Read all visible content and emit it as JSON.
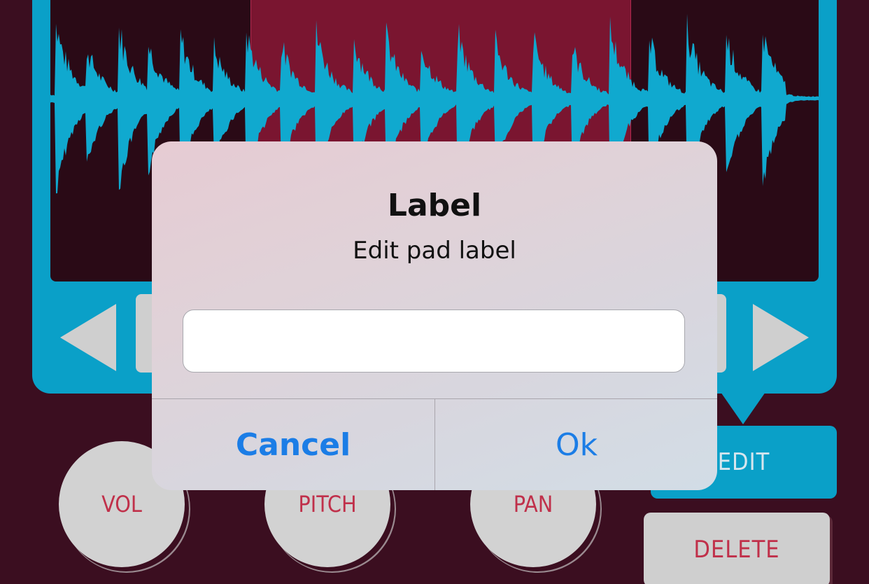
{
  "dialog": {
    "title": "Label",
    "message": "Edit pad label",
    "input_value": "",
    "cancel_label": "Cancel",
    "ok_label": "Ok"
  },
  "controls": {
    "edit_label": "EDIT",
    "delete_label": "DELETE",
    "knobs": [
      {
        "label": "VOL"
      },
      {
        "label": "PITCH"
      },
      {
        "label": "PAN"
      }
    ]
  },
  "colors": {
    "background": "#3b0e20",
    "accent": "#0aa0c8",
    "selection": "#7a1530",
    "knob_text": "#c0304a",
    "dialog_button": "#1b7de6"
  },
  "icons": {
    "prev": "triangle-left-icon",
    "next": "triangle-right-icon"
  }
}
